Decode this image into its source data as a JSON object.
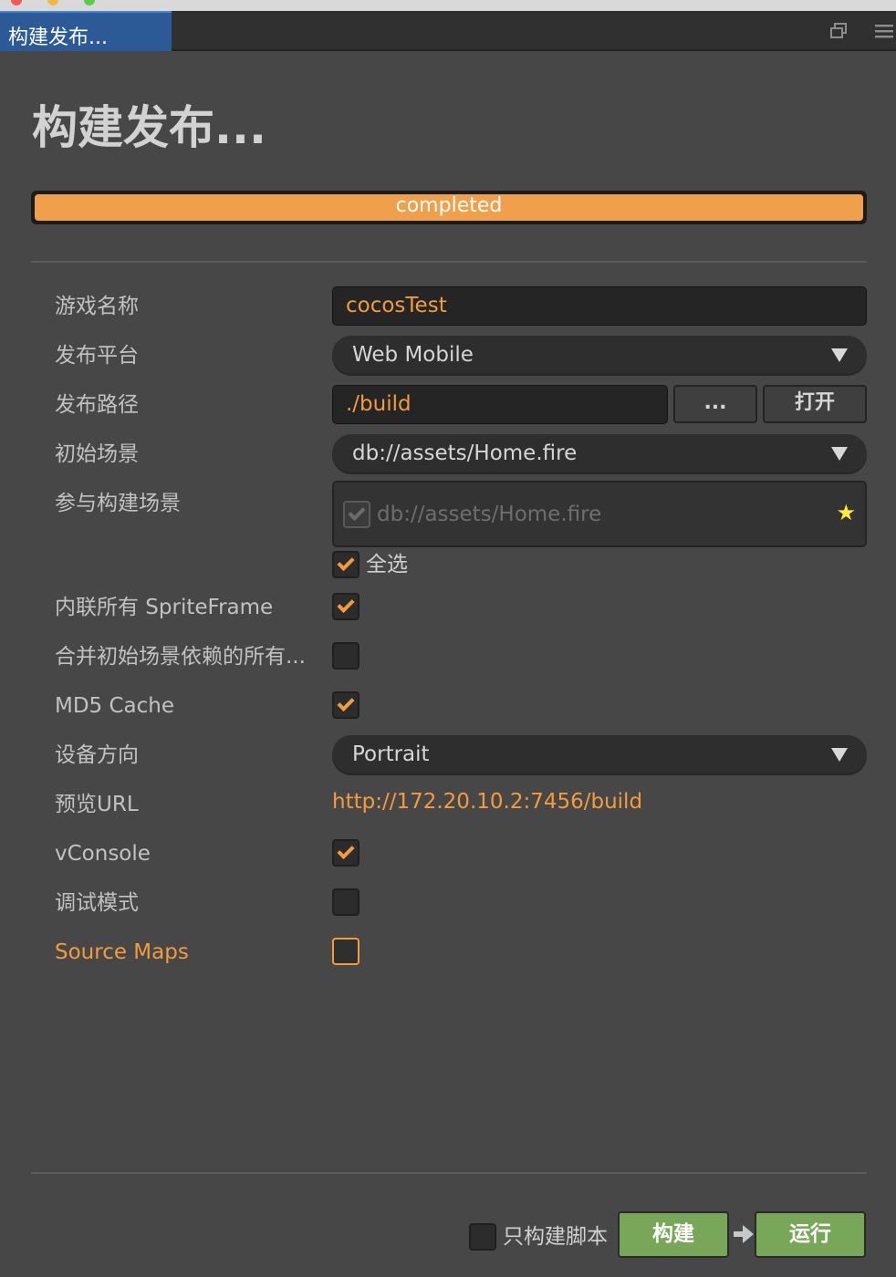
{
  "window": {
    "tab_label": "构建发布...",
    "page_title": "构建发布..."
  },
  "progress": {
    "status_text": "completed",
    "fraction": 1.0,
    "color": "#f0a04b"
  },
  "form": {
    "game_name_label": "游戏名称",
    "game_name_value": "cocosTest",
    "platform_label": "发布平台",
    "platform_value": "Web Mobile",
    "path_label": "发布路径",
    "path_value": "./build",
    "browse_button": "...",
    "open_button": "打开",
    "start_scene_label": "初始场景",
    "start_scene_value": "db://assets/Home.fire",
    "scenes_label": "参与构建场景",
    "scenes": [
      {
        "path": "db://assets/Home.fire",
        "checked": true,
        "disabled": true,
        "icon": "star-icon"
      }
    ],
    "select_all_label": "全选",
    "select_all_checked": true,
    "inline_sprite_label": "内联所有 SpriteFrame",
    "inline_sprite_checked": true,
    "merge_deps_label": "合并初始场景依赖的所有...",
    "merge_deps_checked": false,
    "md5_label": "MD5 Cache",
    "md5_checked": true,
    "orientation_label": "设备方向",
    "orientation_value": "Portrait",
    "preview_url_label": "预览URL",
    "preview_url_value": "http://172.20.10.2:7456/build",
    "vconsole_label": "vConsole",
    "vconsole_checked": true,
    "debug_label": "调试模式",
    "debug_checked": false,
    "source_maps_label": "Source Maps",
    "source_maps_checked": false
  },
  "footer": {
    "script_only_label": "只构建脚本",
    "script_only_checked": false,
    "build_button": "构建",
    "run_button": "运行"
  },
  "colors": {
    "accent": "#f29c3d",
    "tab_active": "#2c5a97",
    "action_green": "#78a75a",
    "background": "#474747"
  }
}
